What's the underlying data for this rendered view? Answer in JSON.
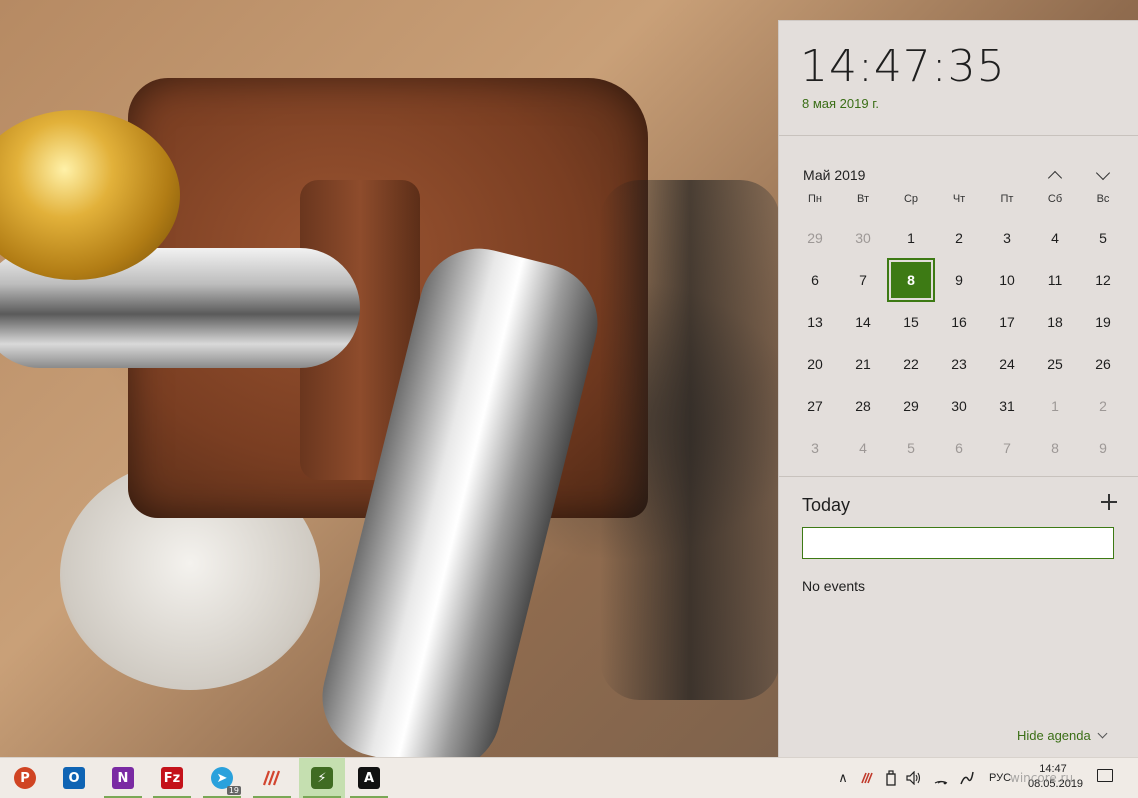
{
  "flyout": {
    "time": "14:47:35",
    "date_long": "8 мая 2019 г.",
    "month_label": "Май 2019",
    "weekdays": [
      "Пн",
      "Вт",
      "Ср",
      "Чт",
      "Пт",
      "Сб",
      "Вс"
    ],
    "days": [
      {
        "n": "29",
        "other": true
      },
      {
        "n": "30",
        "other": true
      },
      {
        "n": "1"
      },
      {
        "n": "2"
      },
      {
        "n": "3"
      },
      {
        "n": "4"
      },
      {
        "n": "5"
      },
      {
        "n": "6"
      },
      {
        "n": "7"
      },
      {
        "n": "8",
        "today": true
      },
      {
        "n": "9"
      },
      {
        "n": "10"
      },
      {
        "n": "11"
      },
      {
        "n": "12"
      },
      {
        "n": "13"
      },
      {
        "n": "14"
      },
      {
        "n": "15"
      },
      {
        "n": "16"
      },
      {
        "n": "17"
      },
      {
        "n": "18"
      },
      {
        "n": "19"
      },
      {
        "n": "20"
      },
      {
        "n": "21"
      },
      {
        "n": "22"
      },
      {
        "n": "23"
      },
      {
        "n": "24"
      },
      {
        "n": "25"
      },
      {
        "n": "26"
      },
      {
        "n": "27"
      },
      {
        "n": "28"
      },
      {
        "n": "29"
      },
      {
        "n": "30"
      },
      {
        "n": "31"
      },
      {
        "n": "1",
        "other": true
      },
      {
        "n": "2",
        "other": true
      },
      {
        "n": "3",
        "other": true
      },
      {
        "n": "4",
        "other": true
      },
      {
        "n": "5",
        "other": true
      },
      {
        "n": "6",
        "other": true
      },
      {
        "n": "7",
        "other": true
      },
      {
        "n": "8",
        "other": true
      },
      {
        "n": "9",
        "other": true
      }
    ],
    "agenda": {
      "heading": "Today",
      "event_input_value": "",
      "empty_text": "No events",
      "hide_label": "Hide agenda"
    }
  },
  "taskbar": {
    "apps": [
      {
        "name": "powerpoint",
        "glyph": "P",
        "running": false
      },
      {
        "name": "outlook",
        "glyph": "O",
        "running": false
      },
      {
        "name": "onenote",
        "glyph": "N",
        "running": true
      },
      {
        "name": "filezilla",
        "glyph": "Fz",
        "running": true
      },
      {
        "name": "telegram",
        "glyph": "➤",
        "running": true,
        "badge": "19"
      },
      {
        "name": "clipboard-app",
        "glyph": "///",
        "running": true
      },
      {
        "name": "usb-app",
        "glyph": "⚡",
        "running": true,
        "active": true
      },
      {
        "name": "a-app",
        "glyph": "A",
        "running": true
      }
    ],
    "language": "РУС",
    "time": "14:47",
    "date": "08.05.2019",
    "watermark": "wincore.ru"
  },
  "colors": {
    "accent": "#3d7a14",
    "link": "#3a6e16",
    "flyout_bg": "#e3dedb",
    "taskbar_bg": "#f0ebe6"
  }
}
